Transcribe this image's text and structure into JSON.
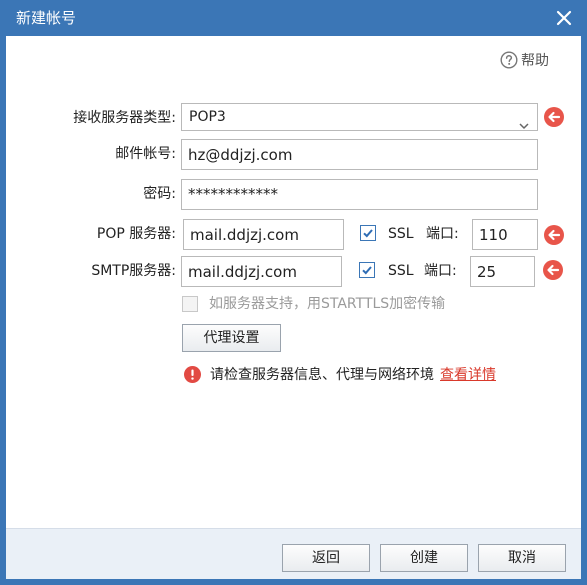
{
  "window": {
    "title": "新建帐号"
  },
  "help": {
    "label": "帮助"
  },
  "form": {
    "server_type": {
      "label": "接收服务器类型:",
      "value": "POP3"
    },
    "email": {
      "label": "邮件帐号:",
      "value": "hz@ddjzj.com"
    },
    "password": {
      "label": "密码:",
      "value": "************"
    },
    "pop": {
      "label": "POP 服务器:",
      "value": "mail.ddjzj.com",
      "ssl_label": "SSL",
      "port_label": "端口:",
      "port": "110",
      "ssl_checked": true
    },
    "smtp": {
      "label": "SMTP服务器:",
      "value": "mail.ddjzj.com",
      "ssl_label": "SSL",
      "port_label": "端口:",
      "port": "25",
      "ssl_checked": true
    },
    "starttls": {
      "label": "如服务器支持，用STARTTLS加密传输",
      "checked": false,
      "enabled": false
    },
    "proxy_button": "代理设置"
  },
  "error": {
    "message": "请检查服务器信息、代理与网络环境",
    "link": "查看详情"
  },
  "footer": {
    "back": "返回",
    "create": "创建",
    "cancel": "取消"
  },
  "colors": {
    "titlebar": "#3b76b6",
    "accent_red": "#e8554a",
    "link_red": "#d9392b",
    "footer_bg": "#eaf0f7"
  }
}
